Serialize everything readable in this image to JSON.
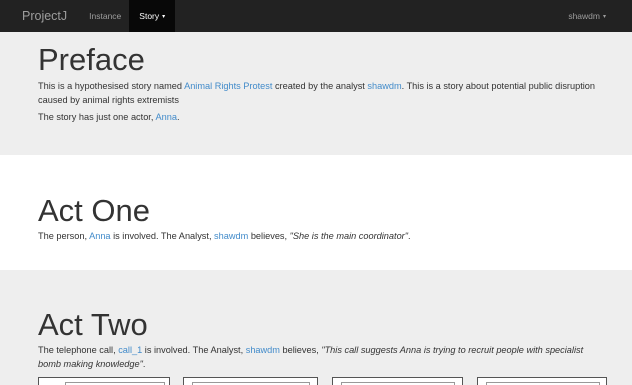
{
  "navbar": {
    "brand": "ProjectJ",
    "items": [
      {
        "label": "Instance"
      },
      {
        "label": "Story",
        "caret": "▾"
      }
    ],
    "user": {
      "label": "shawdm",
      "caret": "▾"
    }
  },
  "preface": {
    "title": "Preface",
    "p1_pre": "This is a hypothesised story named ",
    "story_link": "Animal Rights Protest",
    "p1_mid": " created by the analyst ",
    "analyst_link": "shawdm",
    "p1_post": ". This is a story about potential public disruption caused by animal rights extremists",
    "p2_pre": "The story has just one actor, ",
    "actor_link": "Anna",
    "p2_post": "."
  },
  "act_one": {
    "title": "Act One",
    "text_pre": "The person, ",
    "person_link": "Anna",
    "text_mid": " is involved. The Analyst, ",
    "analyst_link": "shawdm",
    "text_believes": " believes, ",
    "quote": "\"She is the main coordinator\"",
    "text_post": "."
  },
  "act_two": {
    "title": "Act Two",
    "text_pre": "The telephone call, ",
    "call_link": "call_1",
    "text_mid": " is involved. The Analyst, ",
    "analyst_link": "shawdm",
    "text_believes": " believes, ",
    "quote": "\"This call suggests Anna is trying to recruit people with specialist bomb making knowledge\"",
    "text_post": "."
  }
}
